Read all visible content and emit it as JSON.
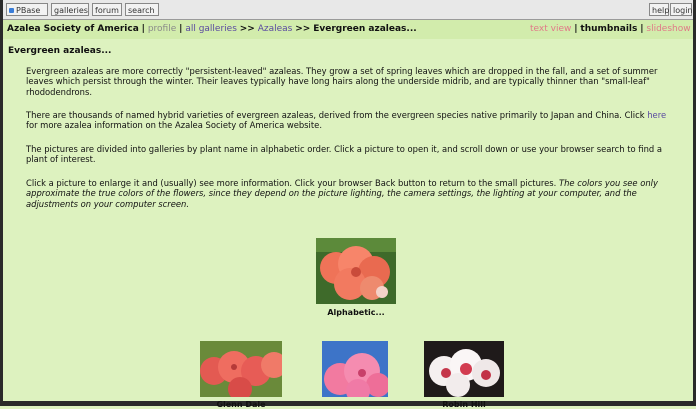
{
  "topbar": {
    "items": [
      "PBase",
      "galleries",
      "forum",
      "search"
    ],
    "help": "help",
    "login": "login"
  },
  "nav": {
    "society": "Azalea Society of America",
    "sep1": "|",
    "profile": "profile",
    "sep2": "|",
    "all_galleries": "all galleries",
    "arrow1": ">>",
    "azaleas": "Azaleas",
    "arrow2": ">>",
    "current": "Evergreen azaleas...",
    "view_links": {
      "text_view": "text view",
      "sep1": "|",
      "thumbnails": "thumbnails",
      "sep2": "|",
      "slideshow": "slideshow"
    }
  },
  "page": {
    "title": "Evergreen azaleas...",
    "p1": "Evergreen azaleas are more correctly \"persistent-leaved\" azaleas. They grow a set of spring leaves which are dropped in the fall, and a set of summer leaves which persist through the winter. Their leaves typically have long hairs along the underside midrib, and are typically thinner than \"small-leaf\" rhododendrons.",
    "p2a": "There are thousands of named hybrid varieties of evergreen azaleas, derived from the evergreen species native primarily to Japan and China. Click ",
    "p2_link": "here",
    "p2b": " for more azalea information on the Azalea Society of America website.",
    "p3": "The pictures are divided into galleries by plant name in alphabetic order. Click a picture to open it, and scroll down or use your browser search to find a plant of interest.",
    "p4a": "Click a picture to enlarge it and (usually) see more information. Click your browser Back button to return to the small pictures. ",
    "p4b": "The colors you see only approximate the true colors of the flowers, since they depend on the picture lighting, the camera settings, the lighting at your computer, and the adjustments on your computer screen."
  },
  "galleries": [
    {
      "caption": "Alphabetic...",
      "icon": "salmon-azalea-flower"
    },
    {
      "caption": "Glenn Dale",
      "icon": "coral-azalea-flower"
    },
    {
      "caption": "",
      "icon": "pink-azalea-flower"
    },
    {
      "caption": "Robin Hill",
      "icon": "white-red-azalea-flower"
    }
  ],
  "colors": {
    "background": "#ddf2bf",
    "nav_bar": "#d2ecac",
    "link": "#5a4aa0",
    "slideshow_link": "#e07a88"
  }
}
